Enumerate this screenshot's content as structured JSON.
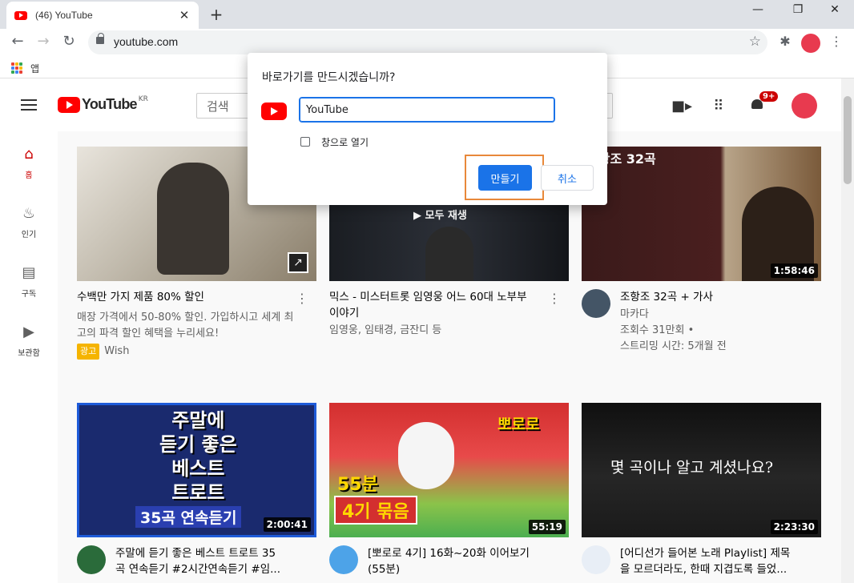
{
  "browser": {
    "tab_title": "(46) YouTube",
    "url": "youtube.com",
    "bookmarks_apps_label": "앱"
  },
  "youtube": {
    "logo_text": "YouTube",
    "logo_region": "KR",
    "search_placeholder": "검색",
    "notification_count": "9+"
  },
  "sidebar": [
    {
      "label": "홈",
      "icon": "home-icon"
    },
    {
      "label": "인기",
      "icon": "flame-icon"
    },
    {
      "label": "구독",
      "icon": "subscriptions-icon"
    },
    {
      "label": "보관함",
      "icon": "library-icon"
    }
  ],
  "dialog": {
    "question": "바로가기를 만드시겠습니까?",
    "name_value": "YouTube",
    "open_as_window_label": "창으로 열기",
    "create_label": "만들기",
    "cancel_label": "취소"
  },
  "videos": [
    {
      "title": "수백만 가지 제품 80% 할인",
      "line2": "매장 가격에서 50-80% 할인. 가입하시고 세계 최",
      "line3": "고의 파격 할인 혜택을 누리세요!",
      "ad_badge": "광고",
      "channel": "Wish"
    },
    {
      "title": "믹스 - 미스터트롯 임영웅 어느 60대 노부부",
      "title2": "이야기",
      "channel": "임영웅, 임태경, 금잔디 등",
      "overlay": "모두 재생"
    },
    {
      "title": "조항조 32곡 + 가사",
      "channel": "마카다",
      "views": "조회수 31만회 •",
      "age": "스트리밍 시간: 5개월 전",
      "duration": "1:58:46",
      "thumb_title": "조항조  32곡"
    },
    {
      "title": "주말에 듣기 좋은 베스트 트로트 35",
      "title2": "곡 연속듣기 #2시간연속듣기 #임...",
      "duration": "2:00:41",
      "thumb_text": [
        "주말에",
        "듣기 좋은",
        "베스트",
        "트로트",
        "35곡 연속듣기"
      ]
    },
    {
      "title": "[뽀로로 4기] 16화~20화 이어보기",
      "title2": "(55분)",
      "duration": "55:19",
      "thumb_text": [
        "55분",
        "4기 묶음",
        "뽀로로"
      ]
    },
    {
      "title": "[어디선가 들어본 노래 Playlist] 제목",
      "title2": "을 모르더라도, 한때 지겹도록 들었...",
      "duration": "2:23:30",
      "thumb_text": "몇 곡이나 알고 계셨나요?"
    }
  ],
  "colors": {
    "brand_red": "#ff0000",
    "accent_blue": "#1a73e8",
    "highlight_orange": "#e8883a"
  }
}
